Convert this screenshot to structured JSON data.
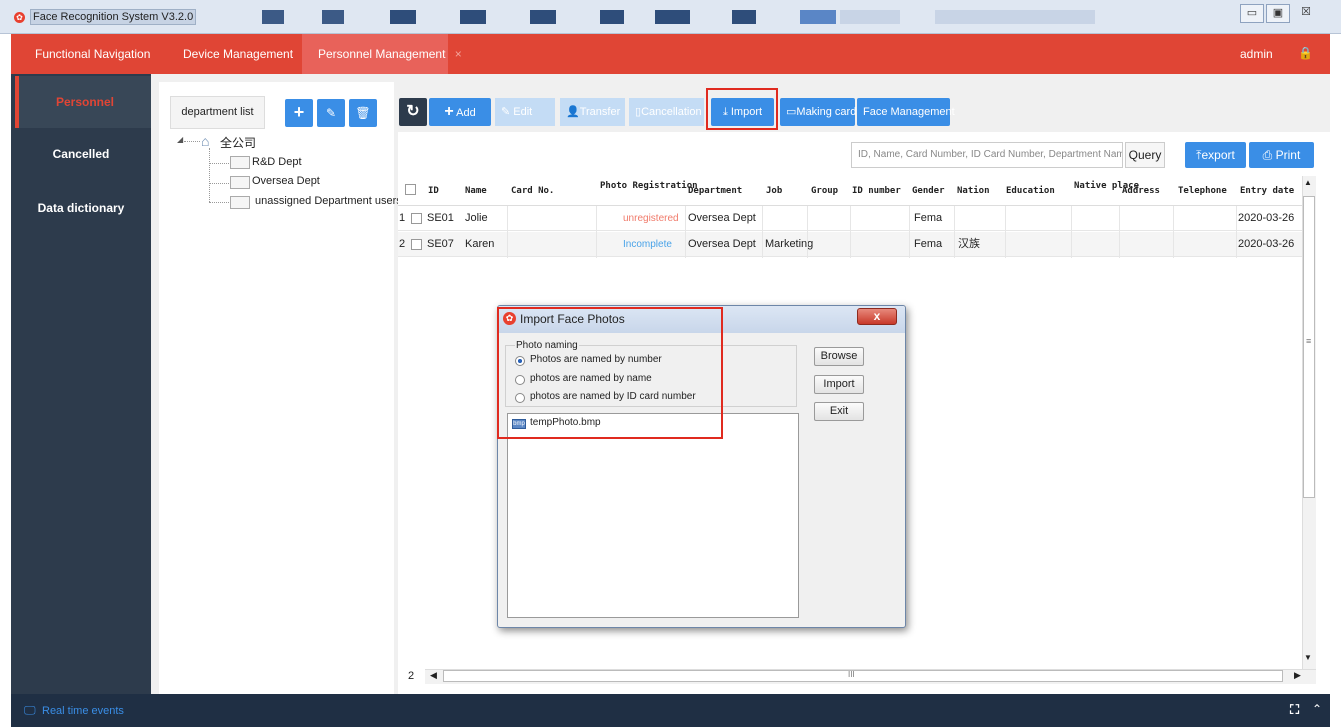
{
  "window": {
    "title": "Face Recognition System V3.2.0",
    "min": "▭",
    "max": "▣",
    "close": "☒"
  },
  "topnav": {
    "items": [
      "Functional Navigation",
      "Device Management",
      "Personnel Management"
    ],
    "tab_close": "×",
    "user": "admin"
  },
  "sidebar": {
    "items": [
      "Personnel",
      "Cancelled",
      "Data dictionary"
    ]
  },
  "dept": {
    "tab_label": "department list",
    "tree": {
      "root": "全公司",
      "children": [
        "R&D Dept",
        "Oversea Dept",
        "unassigned Department users"
      ]
    }
  },
  "toolbar": {
    "refresh": "↻",
    "add": "Add",
    "edit": "Edit",
    "transfer": "Transfer",
    "cancellation": "Cancellation",
    "import": "Import",
    "making_card": "Making card",
    "face_management": "Face Management"
  },
  "search": {
    "placeholder": "ID, Name, Card Number, ID Card Number, Department Name",
    "query": "Query",
    "export": "export",
    "print": "Print"
  },
  "table": {
    "headers": [
      "ID",
      "Name",
      "Card No.",
      "Photo Registration",
      "Department",
      "Job",
      "Group",
      "ID number",
      "Gender",
      "Nation",
      "Education",
      "Native place",
      "Address",
      "Telephone",
      "Entry date"
    ],
    "rows": [
      {
        "no": "1",
        "id": "SE01",
        "name": "Jolie",
        "card": "",
        "photo": "unregistered",
        "dept": "Oversea Dept",
        "job": "",
        "group": "",
        "idnum": "",
        "gender": "Fema",
        "nation": "",
        "edu": "",
        "native": "",
        "address": "",
        "tel": "",
        "entry": "2020-03-26"
      },
      {
        "no": "2",
        "id": "SE07",
        "name": "Karen",
        "card": "",
        "photo": "Incomplete",
        "dept": "Oversea Dept",
        "job": "Marketing",
        "group": "",
        "idnum": "",
        "gender": "Fema",
        "nation": "汉族",
        "edu": "",
        "native": "",
        "address": "",
        "tel": "",
        "entry": "2020-03-26"
      }
    ],
    "page": "2",
    "hscroll_mid": "III"
  },
  "dialog": {
    "title": "Import Face Photos",
    "close": "x",
    "group_label": "Photo naming",
    "options": [
      "Photos are named by number",
      "photos are named by name",
      "photos are named by ID card number"
    ],
    "selected_option": 0,
    "files": [
      "tempPhoto.bmp"
    ],
    "buttons": {
      "browse": "Browse",
      "import": "Import",
      "exit": "Exit"
    }
  },
  "footer": {
    "label": "Real time events"
  },
  "colors": {
    "nav": "#e04535",
    "sidebar": "#2d3b4c",
    "accent": "#3a8ee6",
    "unregistered": "#f07a6a",
    "incomplete": "#4aa3e8",
    "highlight": "#e02a1f"
  }
}
